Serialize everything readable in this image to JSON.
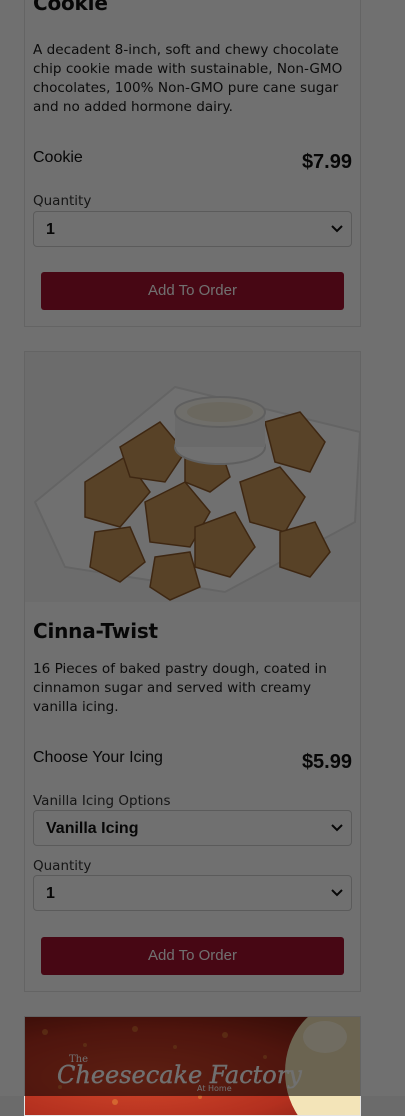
{
  "products": [
    {
      "title": "Cookie",
      "description": "A decadent 8-inch, soft and chewy chocolate chip cookie made with sustainable, Non-GMO chocolates, 100% Non-GMO pure cane sugar and no added hormone dairy.",
      "option_label": "Cookie",
      "price": "$7.99",
      "quantity_label": "Quantity",
      "quantity_value": "1",
      "button_label": "Add To Order"
    },
    {
      "title": "Cinna-Twist",
      "description": "16 Pieces of baked pastry dough, coated in cinnamon sugar and served with creamy vanilla icing.",
      "option_label": "Choose Your Icing",
      "price": "$5.99",
      "icing_label": "Vanilla Icing Options",
      "icing_value": "Vanilla Icing",
      "quantity_label": "Quantity",
      "quantity_value": "1",
      "button_label": "Add To Order"
    }
  ],
  "promo_banner": {
    "logo_text": "TheCheesecakeFactory",
    "logo_sub": "At Home"
  },
  "colors": {
    "button": "#a3122e",
    "overlay": "rgba(0,0,0,0.56)"
  },
  "icons": [
    "chevron-down-icon",
    "chevron-down-icon",
    "chevron-down-icon"
  ]
}
